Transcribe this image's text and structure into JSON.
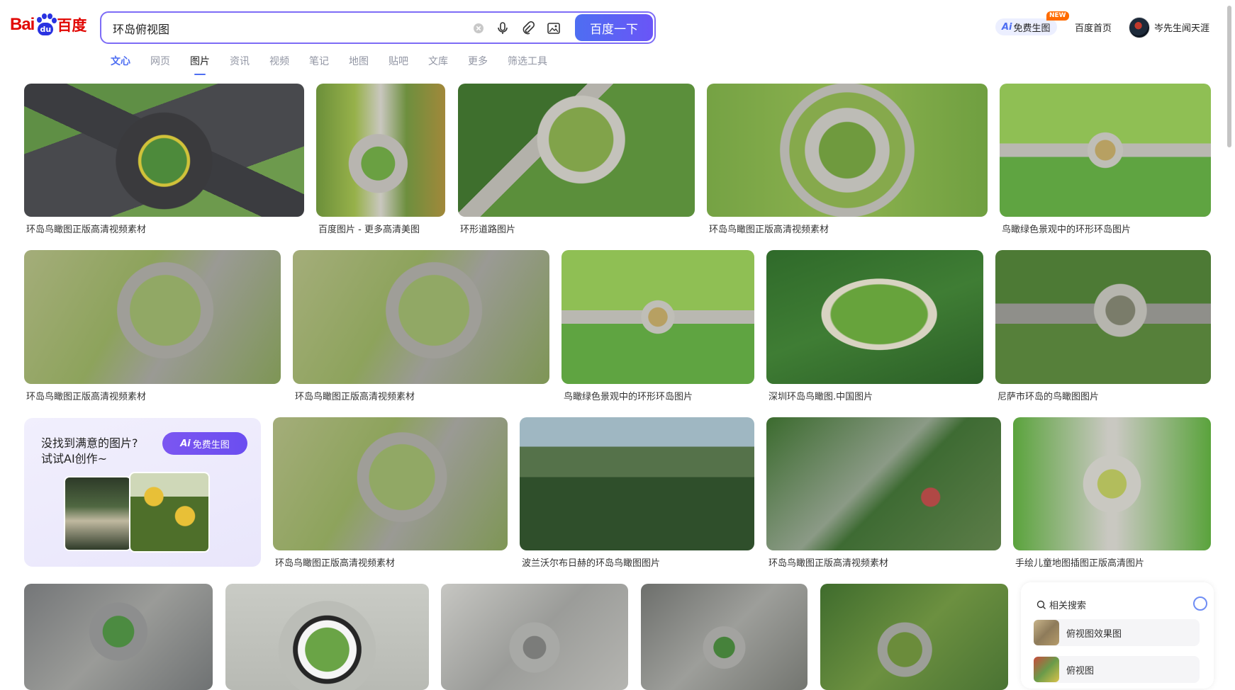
{
  "header": {
    "logo_bai": "Bai",
    "logo_du": "du",
    "logo_cn": "百度",
    "search_value": "环岛俯视图",
    "search_button": "百度一下",
    "ai_pill": "免费生图",
    "ai_prefix": "Ai",
    "badge": "NEW",
    "home": "百度首页",
    "username": "岑先生闻天涯"
  },
  "tabs": [
    "文心",
    "网页",
    "图片",
    "资讯",
    "视频",
    "笔记",
    "地图",
    "贴吧",
    "文库",
    "更多",
    "筛选工具"
  ],
  "results": [
    "环岛鸟瞰图正版高清视频素材",
    "百度图片 - 更多高清美图",
    "环形道路图片",
    "环岛鸟瞰图正版高清视频素材",
    "鸟瞰绿色景观中的环形环岛图片",
    "环岛鸟瞰图正版高清视频素材",
    "环岛鸟瞰图正版高清视频素材",
    "鸟瞰绿色景观中的环形环岛图片",
    "深圳环岛鸟瞰图.中国图片",
    "尼萨市环岛的鸟瞰图图片",
    "环岛鸟瞰图正版高清视频素材",
    "波兰沃尔布日赫的环岛鸟瞰图图片",
    "环岛鸟瞰图正版高清视频素材",
    "手绘儿童地图插图正版高清图片"
  ],
  "promo": {
    "line1": "没找到满意的图片?",
    "line2": "试试AI创作~",
    "button_prefix": "Ai",
    "button": "免费生图"
  },
  "related": {
    "title": "相关搜索",
    "items": [
      "俯视图效果图",
      "俯视图"
    ]
  }
}
